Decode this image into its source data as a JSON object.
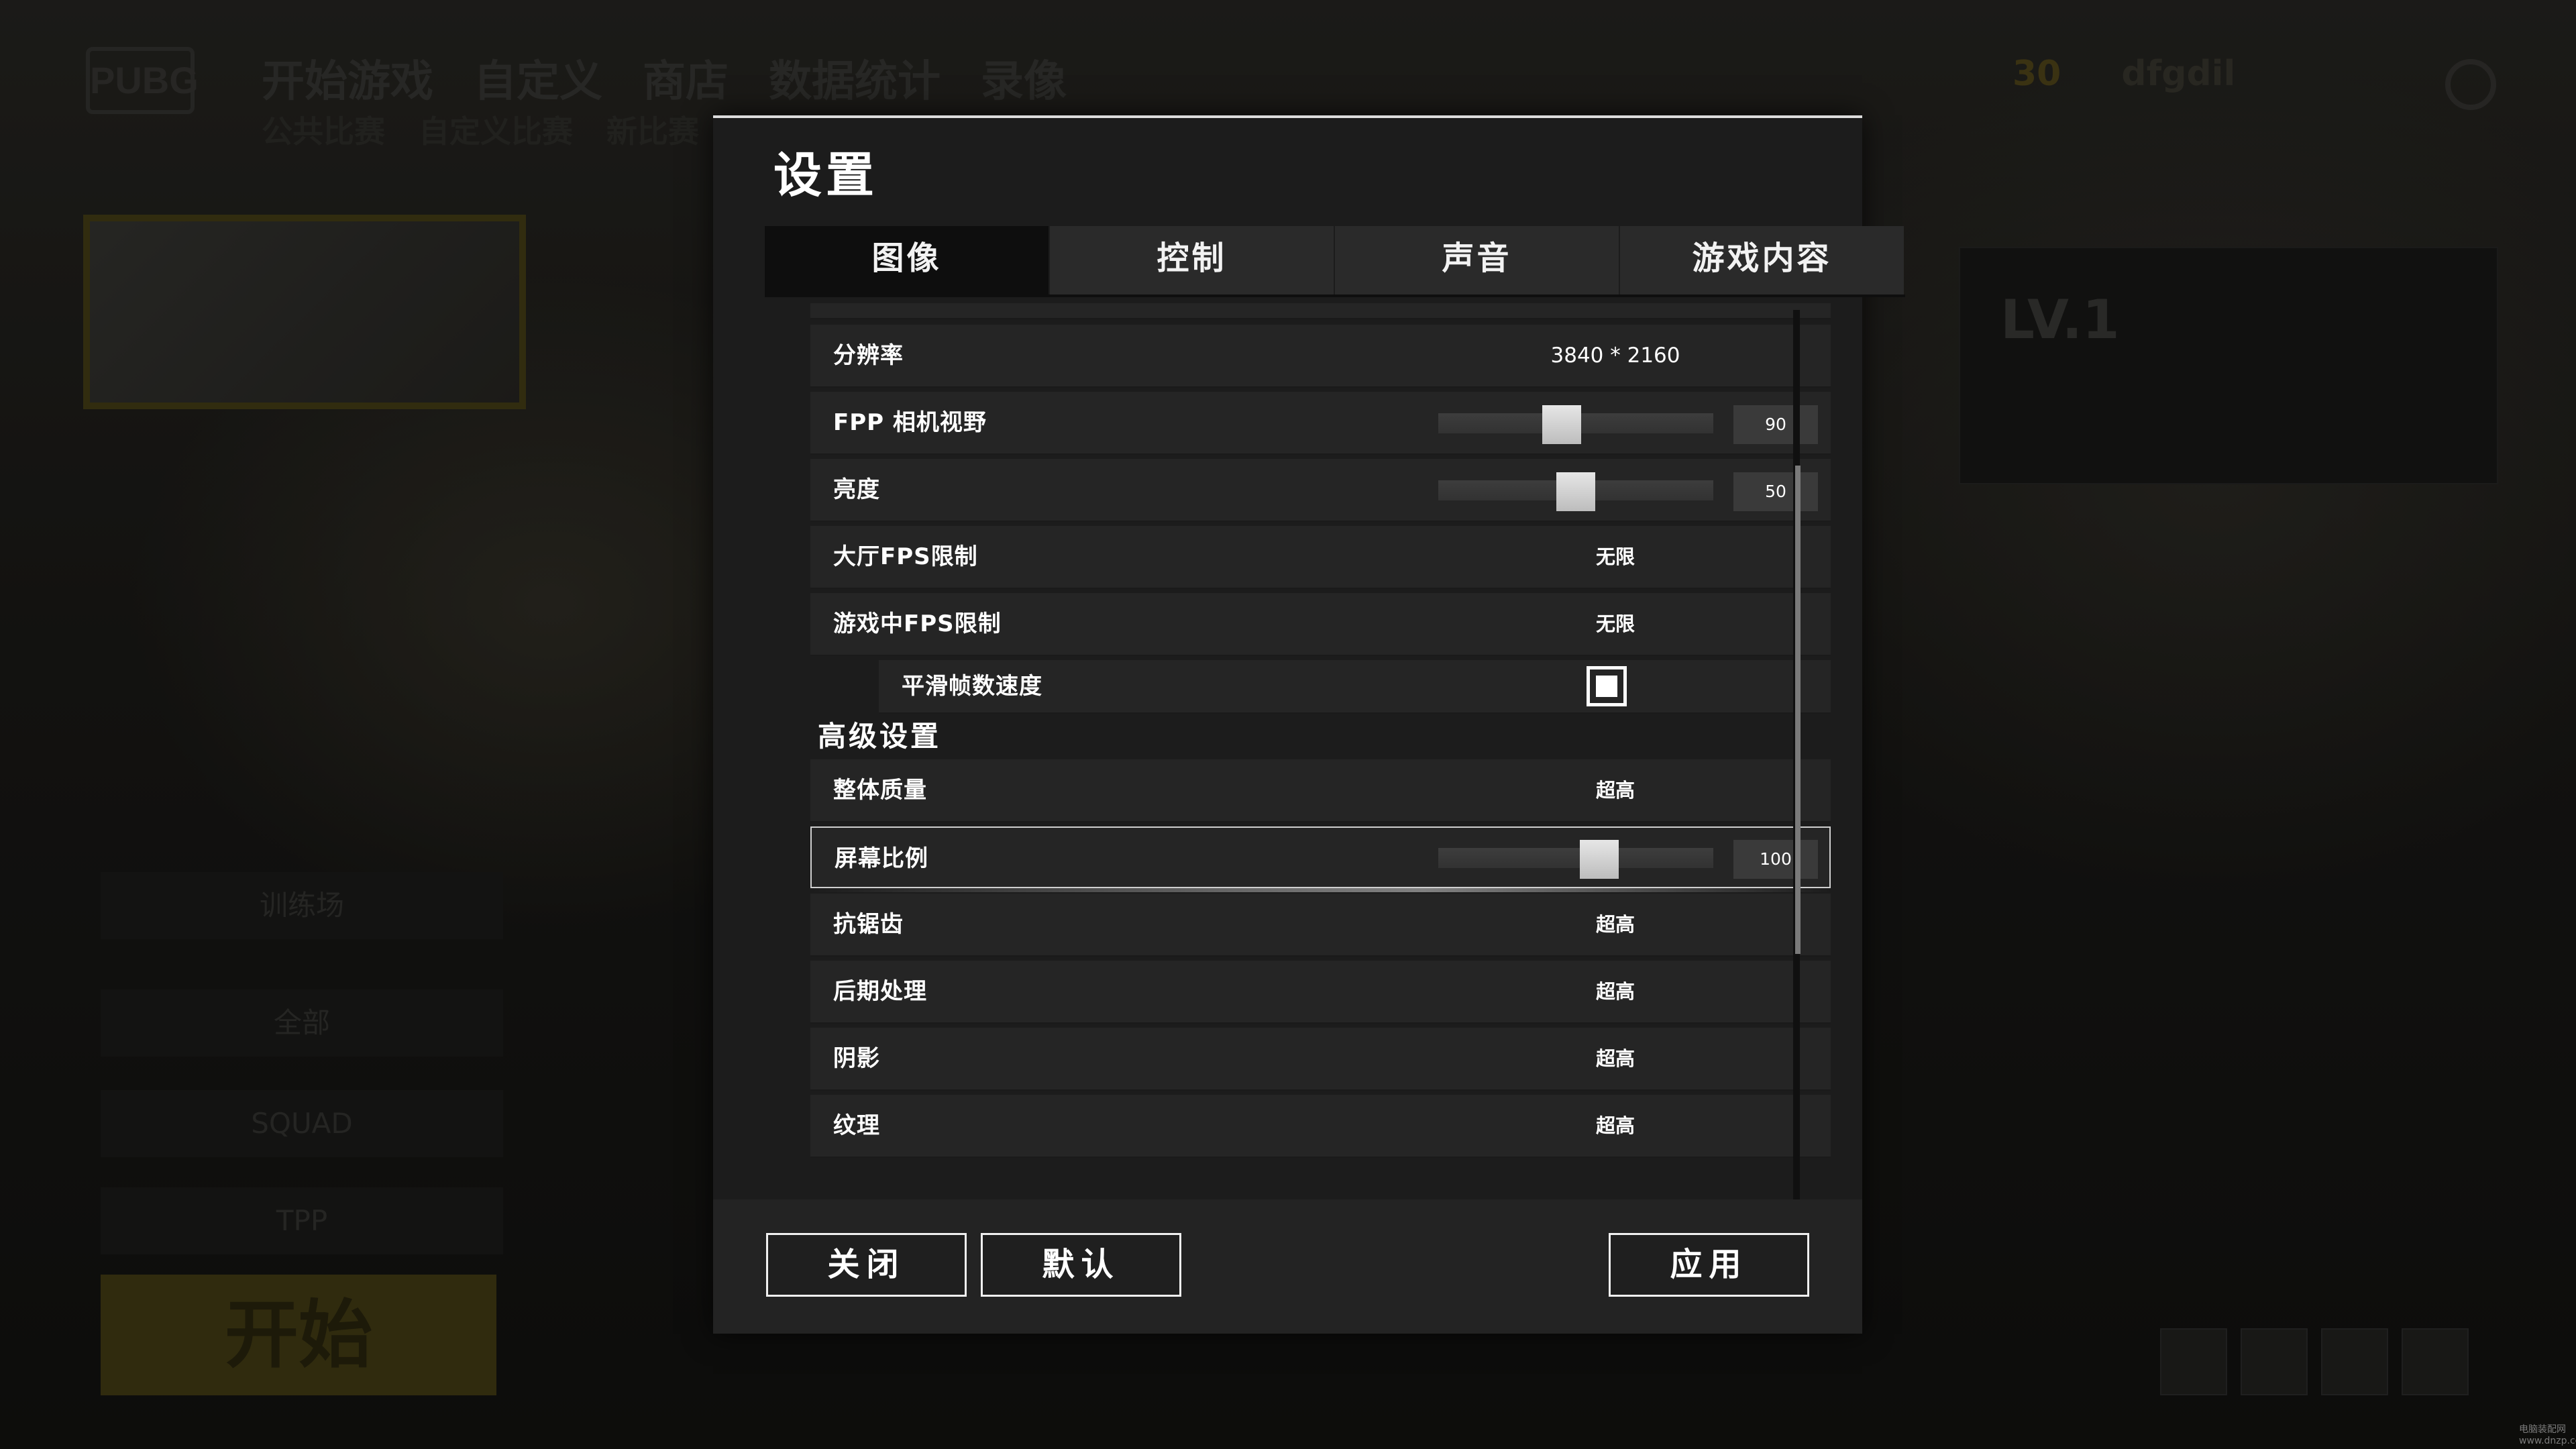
{
  "background": {
    "logo": "PUBG",
    "nav": [
      "开始游戏",
      "自定义",
      "商店",
      "数据统计",
      "录像"
    ],
    "subnav": [
      "公共比赛",
      "自定义比赛",
      "新比赛"
    ],
    "topright": {
      "coins": "30",
      "username": "dfgdil"
    },
    "level": "LV.1",
    "panels": [
      "训练场",
      "全部",
      "SQUAD",
      "TPP"
    ],
    "start_button": "开始",
    "watermark": "电脑装配网 www.dnzp.com"
  },
  "dialog": {
    "title": "设置",
    "tabs": [
      {
        "label": "图像",
        "active": true
      },
      {
        "label": "控制",
        "active": false
      },
      {
        "label": "声音",
        "active": false
      },
      {
        "label": "游戏内容",
        "active": false
      }
    ],
    "rows": {
      "resolution": {
        "label": "分辨率",
        "value": "3840 * 2160"
      },
      "fpp_fov": {
        "label": "FPP 相机视野",
        "value": "90",
        "level": 0.44
      },
      "brightness": {
        "label": "亮度",
        "value": "50",
        "level": 0.5
      },
      "lobby_fps": {
        "label": "大厅FPS限制",
        "value": "无限"
      },
      "ingame_fps": {
        "label": "游戏中FPS限制",
        "value": "无限"
      },
      "smooth_framerate": {
        "label": "平滑帧数速度",
        "checked": true
      },
      "overall_quality": {
        "label": "整体质量",
        "value": "超高"
      },
      "screen_scale": {
        "label": "屏幕比例",
        "value": "100",
        "level": 0.6
      },
      "anti_aliasing": {
        "label": "抗锯齿",
        "value": "超高"
      },
      "post_processing": {
        "label": "后期处理",
        "value": "超高"
      },
      "shadows": {
        "label": "阴影",
        "value": "超高"
      },
      "textures": {
        "label": "纹理",
        "value": "超高"
      }
    },
    "advanced_header": "高级设置",
    "buttons": {
      "close": "关闭",
      "default": "默认",
      "apply": "应用"
    }
  }
}
